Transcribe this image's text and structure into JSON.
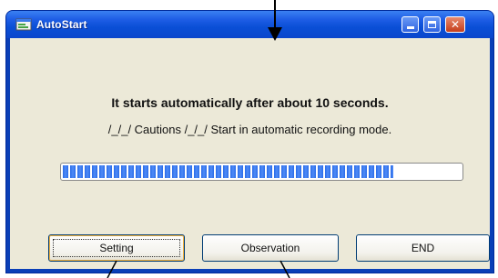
{
  "window": {
    "title": "AutoStart",
    "controls": {
      "minimize": "minimize-icon",
      "maximize": "maximize-icon",
      "close": "close-icon"
    }
  },
  "message": {
    "main": "It starts automatically after about 10 seconds.",
    "sub": "/_/_/ Cautions /_/_/ Start in automatic recording mode."
  },
  "progress": {
    "value": 0.83
  },
  "buttons": {
    "setting": "Setting",
    "observation": "Observation",
    "end": "END"
  },
  "colors": {
    "titlebar": "#0a4fd6",
    "client_bg": "#ece9d8",
    "progress_fill": "#2a6be8",
    "close_button": "#c53d1b"
  }
}
